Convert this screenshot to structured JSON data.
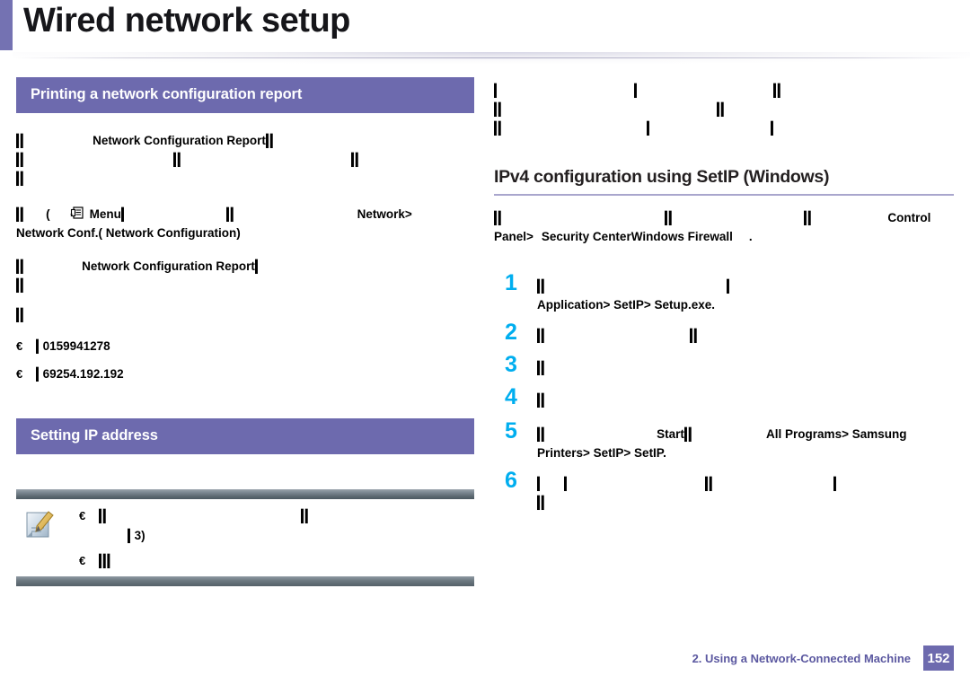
{
  "page": {
    "title": "Wired network setup",
    "accent_color": "#7472B2",
    "section_bar_color": "#6D6AAE",
    "step_number_color": "#00AEEF"
  },
  "left_column": {
    "section_bar_1": "Printing a network configuration report",
    "paragraph_1": {
      "line1_bold": "Network Configuration Report",
      "line2": "",
      "line3": ""
    },
    "procedure": {
      "menu_icon": "menu-icon",
      "open_paren": "(",
      "menu_label": "Menu",
      "path_label": "Network>",
      "path_label_2": "Network Conf.( Network Configuration)"
    },
    "paragraph_2": {
      "bold_run": "Network Configuration Report"
    },
    "bullets": [
      {
        "mark": "€",
        "text": "0159941278"
      },
      {
        "mark": "€",
        "text": "69254.192.192"
      }
    ],
    "section_bar_2": "Setting IP address",
    "note": {
      "icon": "note-pencil-icon",
      "bullets": [
        {
          "mark": "€",
          "text": "3)"
        },
        {
          "mark": "€",
          "text": ""
        }
      ]
    }
  },
  "right_column": {
    "intro_lines": [
      "",
      "",
      ""
    ],
    "sub_heading": "IPv4 configuration using SetIP (Windows)",
    "note_paragraph": {
      "bold_1": "Control",
      "bold_2": "Panel>",
      "bold_3": "Security Center",
      "bold_4": "Windows Firewall",
      "period": "."
    },
    "steps": [
      {
        "number": "1",
        "bold_path": "Application> SetIP> Setup.exe."
      },
      {
        "number": "2",
        "bold_path": ""
      },
      {
        "number": "3",
        "bold_path": ""
      },
      {
        "number": "4",
        "bold_path": ""
      },
      {
        "number": "5",
        "bold_1": "Start",
        "bold_2": "All Programs> Samsung",
        "bold_3": "Printers> SetIP> SetIP."
      },
      {
        "number": "6",
        "bold_path": ""
      }
    ]
  },
  "footer": {
    "chapter": "2.  Using a Network-Connected Machine",
    "page_number": "152"
  }
}
